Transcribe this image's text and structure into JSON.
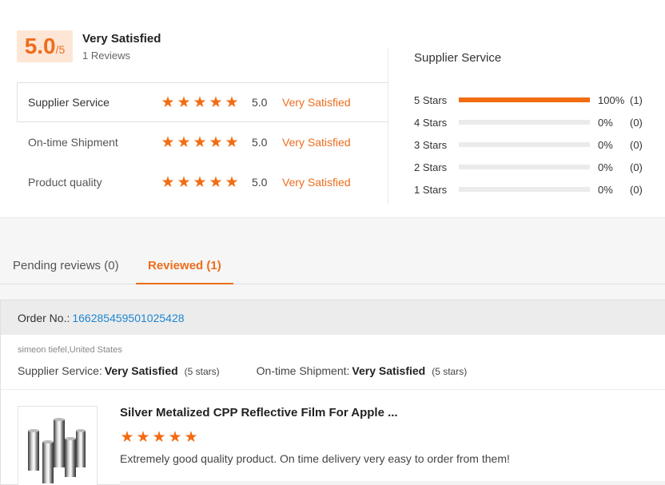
{
  "summary": {
    "score": "5.0",
    "score_max": "/5",
    "label": "Very Satisfied",
    "review_count": "1 Reviews"
  },
  "metrics": [
    {
      "name": "Supplier Service",
      "stars": 5,
      "score": "5.0",
      "desc": "Very Satisfied"
    },
    {
      "name": "On-time Shipment",
      "stars": 5,
      "score": "5.0",
      "desc": "Very Satisfied"
    },
    {
      "name": "Product quality",
      "stars": 5,
      "score": "5.0",
      "desc": "Very Satisfied"
    }
  ],
  "distribution": {
    "title": "Supplier Service",
    "rows": [
      {
        "label": "5  Stars",
        "fraction": 1.0,
        "pct": "100%",
        "count": "(1)"
      },
      {
        "label": "4  Stars",
        "fraction": 0.0,
        "pct": "0%",
        "count": "(0)"
      },
      {
        "label": "3  Stars",
        "fraction": 0.0,
        "pct": "0%",
        "count": "(0)"
      },
      {
        "label": "2  Stars",
        "fraction": 0.0,
        "pct": "0%",
        "count": "(0)"
      },
      {
        "label": "1  Stars",
        "fraction": 0.0,
        "pct": "0%",
        "count": "(0)"
      }
    ]
  },
  "tabs": {
    "pending": "Pending reviews (0)",
    "reviewed": "Reviewed (1)"
  },
  "order": {
    "label": "Order No.:",
    "number": "166285459501025428",
    "buyer": "simeon tiefel,United States",
    "supplier_service_label": "Supplier Service:",
    "supplier_service_value": "Very Satisfied",
    "supplier_service_stars": "(5 stars)",
    "shipment_label": "On-time Shipment:",
    "shipment_value": "Very Satisfied",
    "shipment_stars": "(5 stars)",
    "product_title": "Silver Metalized CPP Reflective Film For Apple ...",
    "product_stars": 5,
    "review_text": "Extremely good quality product. On time delivery very easy to order from them!"
  },
  "colors": {
    "accent": "#ee6d1c",
    "star": "#f26c12",
    "link": "#1f86d1"
  },
  "icons": {
    "star": "star-icon",
    "product": "product-thumbnail"
  }
}
